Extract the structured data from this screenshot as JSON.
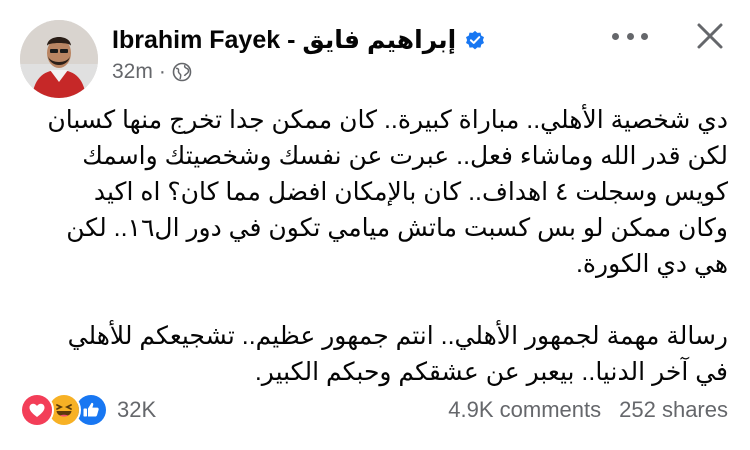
{
  "post": {
    "author_name": "Ibrahim Fayek - إبراهيم  فايق",
    "time": "32m",
    "audience_icon": "globe-icon",
    "more_icon": "more-options-icon",
    "close_icon": "close-icon",
    "body_paragraphs": [
      "دي شخصية الأهلي.. مباراة كبيرة.. كان ممكن جدا تخرج منها كسبان لكن قدر الله وماشاء فعل.. عبرت عن نفسك وشخصيتك واسمك كويس وسجلت ٤ اهداف.. كان بالإمكان افضل مما كان؟ اه اكيد وكان ممكن لو بس كسبت ماتش ميامي تكون في دور ال١٦.. لكن هي دي الكورة.",
      "رسالة مهمة لجمهور الأهلي.. انتم جمهور عظيم.. تشجيعكم للأهلي في آخر الدنيا.. بيعبر عن عشقكم وحبكم الكبير."
    ]
  },
  "engagement": {
    "reaction_icons": [
      "love-icon",
      "haha-icon",
      "like-icon"
    ],
    "reaction_count": "32K",
    "comments": "4.9K comments",
    "shares": "252 shares"
  },
  "colors": {
    "verified_blue": "#1877f2",
    "love_red": "#f33e58",
    "haha_yellow": "#f7b125",
    "like_blue": "#1877f2",
    "secondary_text": "#65676b"
  }
}
